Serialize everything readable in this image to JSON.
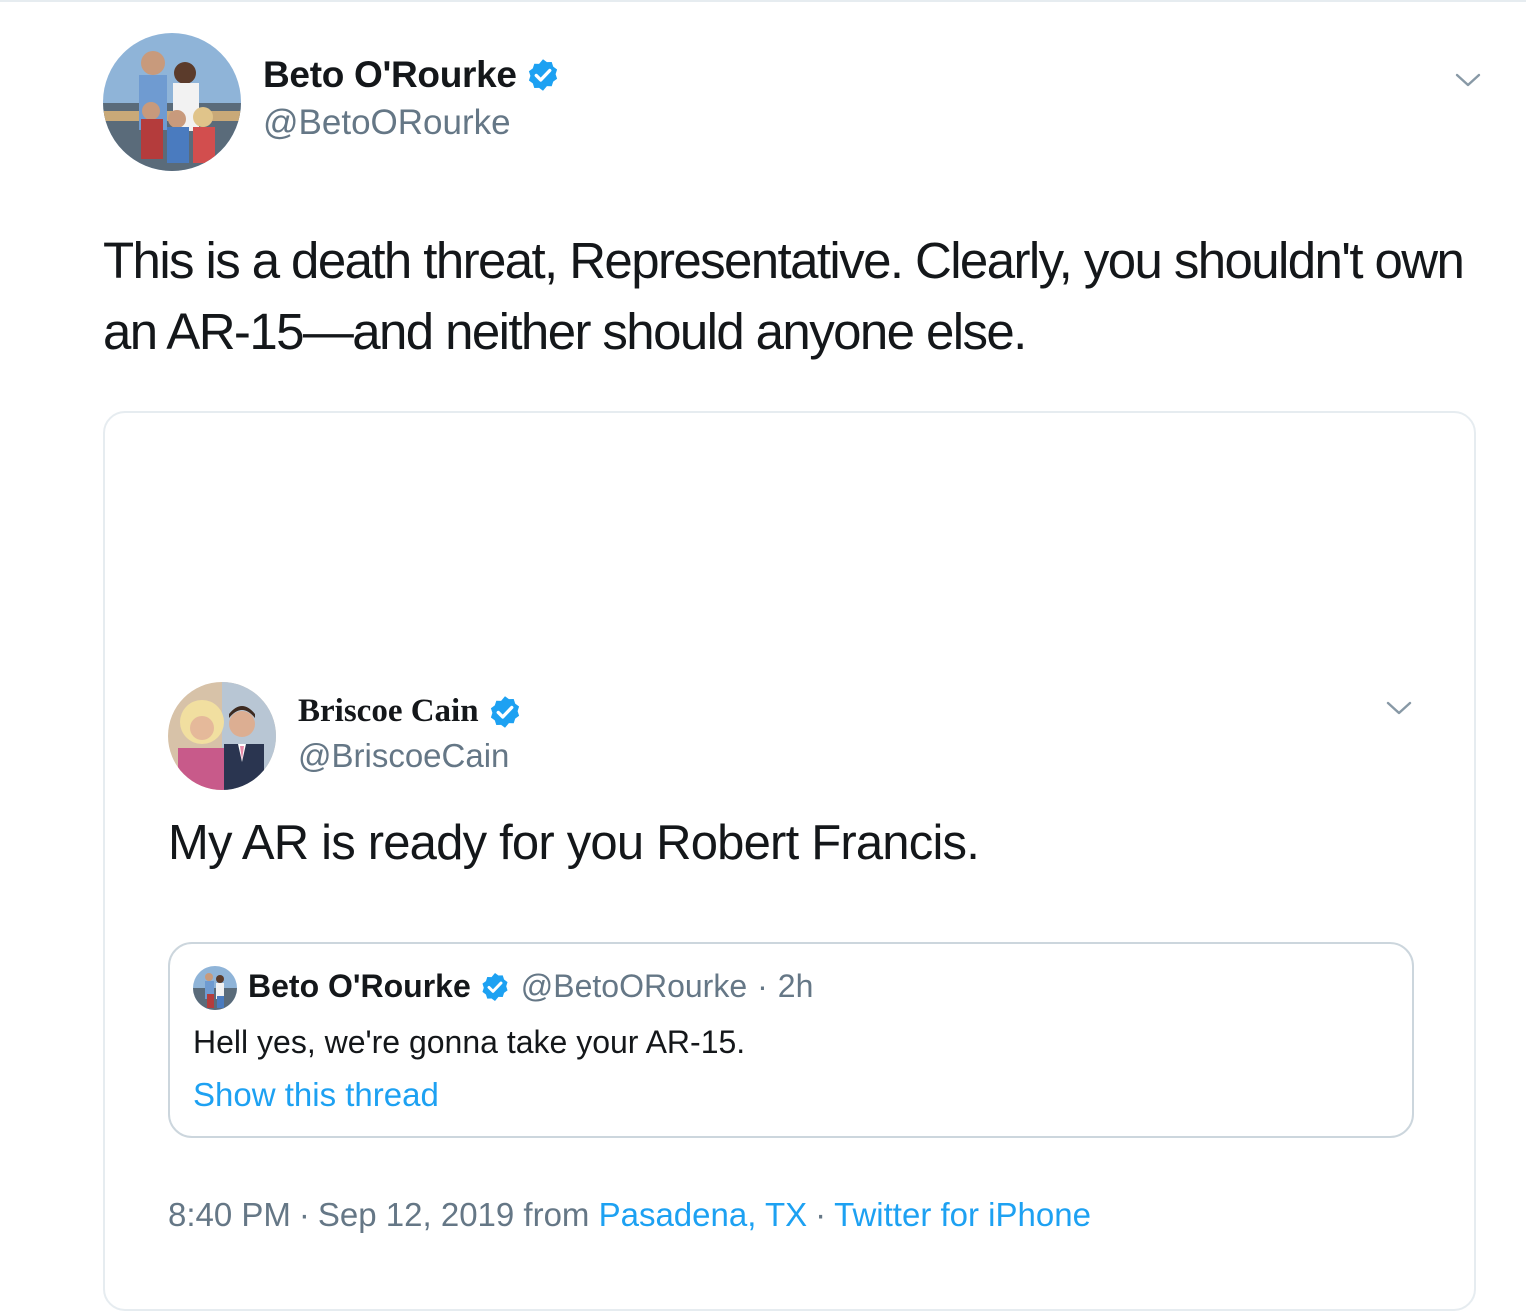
{
  "tweet": {
    "author_name": "Beto O'Rourke",
    "author_handle": "@BetoORourke",
    "verified": true,
    "text": "This is a death threat, Representative. Clearly, you shouldn't own an AR-15—and neither should anyone else.",
    "menu_icon": "chevron-down-icon"
  },
  "embedded_tweet": {
    "author_name": "Briscoe Cain",
    "author_handle": "@BriscoeCain",
    "verified": true,
    "text": "My AR is ready for you Robert Francis.",
    "menu_icon": "chevron-down-icon",
    "quoted_tweet": {
      "author_name": "Beto O'Rourke",
      "author_handle": "@BetoORourke",
      "separator": "·",
      "time_ago": "2h",
      "text": "Hell yes, we're gonna take your AR-15.",
      "show_thread_label": "Show this thread"
    },
    "meta": {
      "time": "8:40 PM",
      "separator": "·",
      "date": "Sep 12, 2019",
      "from_label": "from",
      "location": "Pasadena, TX",
      "client": "Twitter for iPhone"
    }
  },
  "colors": {
    "accent": "#1da1f2",
    "text_primary": "#14171a",
    "text_secondary": "#657786",
    "border": "#e6ecf0"
  }
}
